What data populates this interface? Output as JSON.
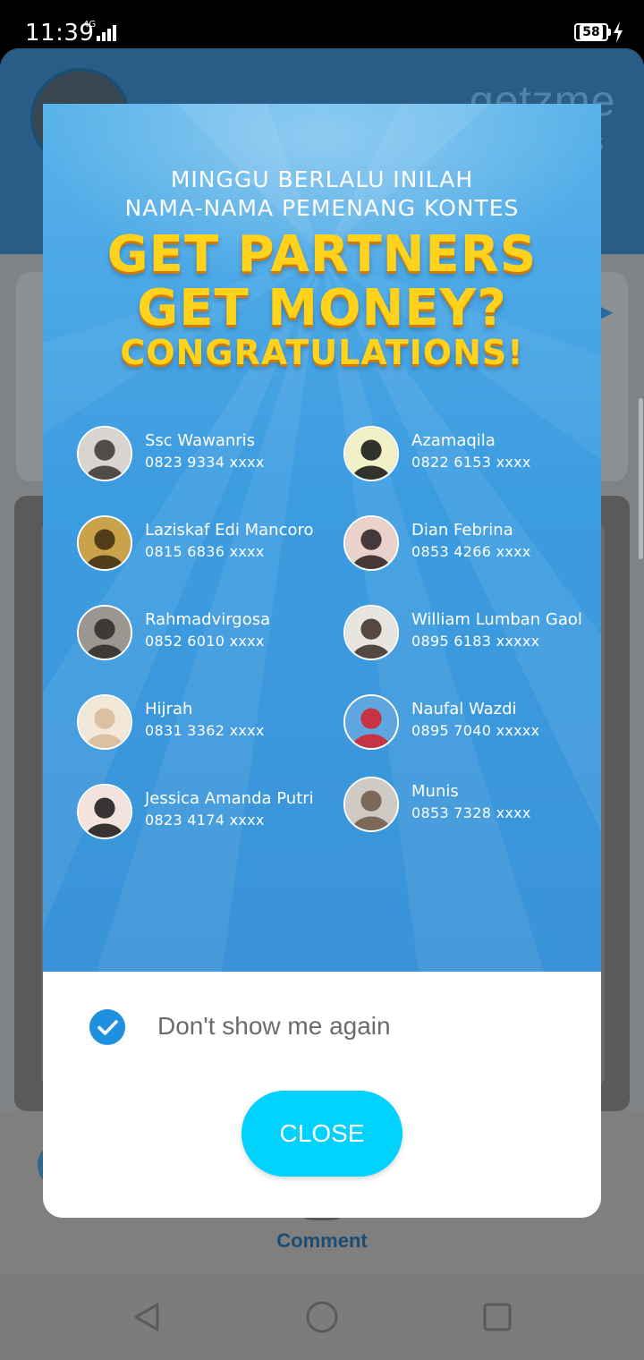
{
  "status_bar": {
    "time": "11:39",
    "network": "4G",
    "battery": "58"
  },
  "background_app": {
    "logo_text": "getzme",
    "logo_sub": "s",
    "comment_label": "Comment"
  },
  "popup": {
    "line1": "MINGGU BERLALU INILAH",
    "line2": "NAMA-NAMA PEMENANG KONTES",
    "headline1": "GET PARTNERS",
    "headline2": "GET MONEY?",
    "headline3": "CONGRATULATIONS!",
    "winners": [
      {
        "name": "Ssc Wawanris",
        "phone": "0823 9334 xxxx",
        "avatar_colors": [
          "#d8d4cf",
          "#3a3430"
        ]
      },
      {
        "name": "Azamaqila",
        "phone": "0822 6153 xxxx",
        "avatar_colors": [
          "#f2f0c6",
          "#101010"
        ]
      },
      {
        "name": "Laziskaf Edi Mancoro",
        "phone": "0815 6836 xxxx",
        "avatar_colors": [
          "#c9a24a",
          "#3e2a12"
        ]
      },
      {
        "name": "Dian Febrina",
        "phone": "0853 4266 xxxx",
        "avatar_colors": [
          "#e9d2cc",
          "#2a1e1e"
        ]
      },
      {
        "name": "Rahmadvirgosa",
        "phone": "0852 6010 xxxx",
        "avatar_colors": [
          "#9c9690",
          "#2e2a28"
        ]
      },
      {
        "name": "William Lumban Gaol",
        "phone": "0895 6183 xxxxx",
        "avatar_colors": [
          "#e8e4e0",
          "#3b2b24"
        ]
      },
      {
        "name": "Hijrah",
        "phone": "0831 3362 xxxx",
        "avatar_colors": [
          "#f3e8d8",
          "#d7b899"
        ]
      },
      {
        "name": "Naufal Wazdi",
        "phone": "0895 7040 xxxxx",
        "avatar_colors": [
          "#5fa6e0",
          "#d81f26"
        ]
      },
      {
        "name": "Jessica Amanda Putri",
        "phone": "0823 4174 xxxx",
        "avatar_colors": [
          "#f3e3dc",
          "#141414"
        ]
      },
      {
        "name": "Munis",
        "phone": "0853 7328 xxxx",
        "avatar_colors": [
          "#cfcac4",
          "#6f5848"
        ]
      }
    ],
    "dont_show_label": "Don't show me again",
    "dont_show_checked": true,
    "close_label": "CLOSE"
  },
  "colors": {
    "banner_blue": "#3c9ce0",
    "headline_yellow": "#ffd21c",
    "close_button": "#00d2ff",
    "checkbox": "#1f8fe0"
  },
  "icons": [
    "signal-icon",
    "battery-icon",
    "charging-icon",
    "checkbox-checked-icon",
    "back-icon",
    "home-icon",
    "recents-icon"
  ]
}
